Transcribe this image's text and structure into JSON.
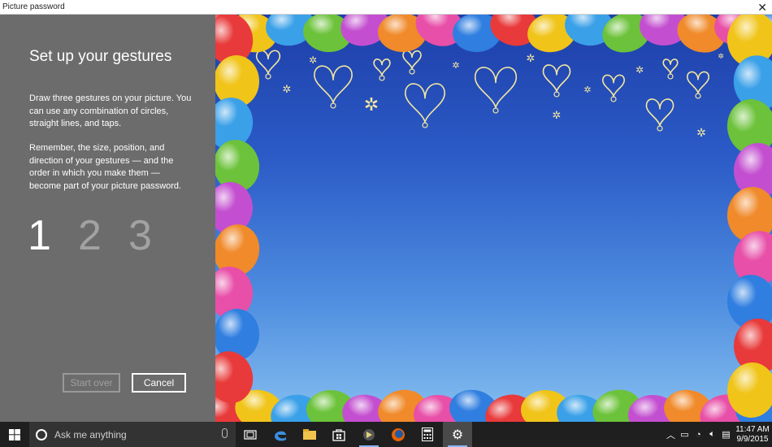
{
  "window": {
    "title": "Picture password"
  },
  "panel": {
    "heading": "Set up your gestures",
    "instructions": "Draw three gestures on your picture. You can use any combination of circles, straight lines, and taps.",
    "reminder": "Remember, the size, position, and direction of your gestures — and the order in which you make them — become part of your picture password.",
    "steps": [
      "1",
      "2",
      "3"
    ],
    "current_step": 1,
    "start_over_label": "Start over",
    "cancel_label": "Cancel"
  },
  "colors": {
    "panel_bg": "#6c6c6c",
    "sky_top": "#1e3ea8",
    "sky_bottom": "#86bff0",
    "accent": "#ffffff"
  },
  "taskbar": {
    "search_placeholder": "Ask me anything",
    "apps": [
      "task-view-icon",
      "edge-icon",
      "file-explorer-icon",
      "store-icon",
      "media-icon",
      "firefox-icon",
      "calculator-icon",
      "settings-icon"
    ],
    "time": "11:47 AM",
    "date": "9/9/2015"
  }
}
